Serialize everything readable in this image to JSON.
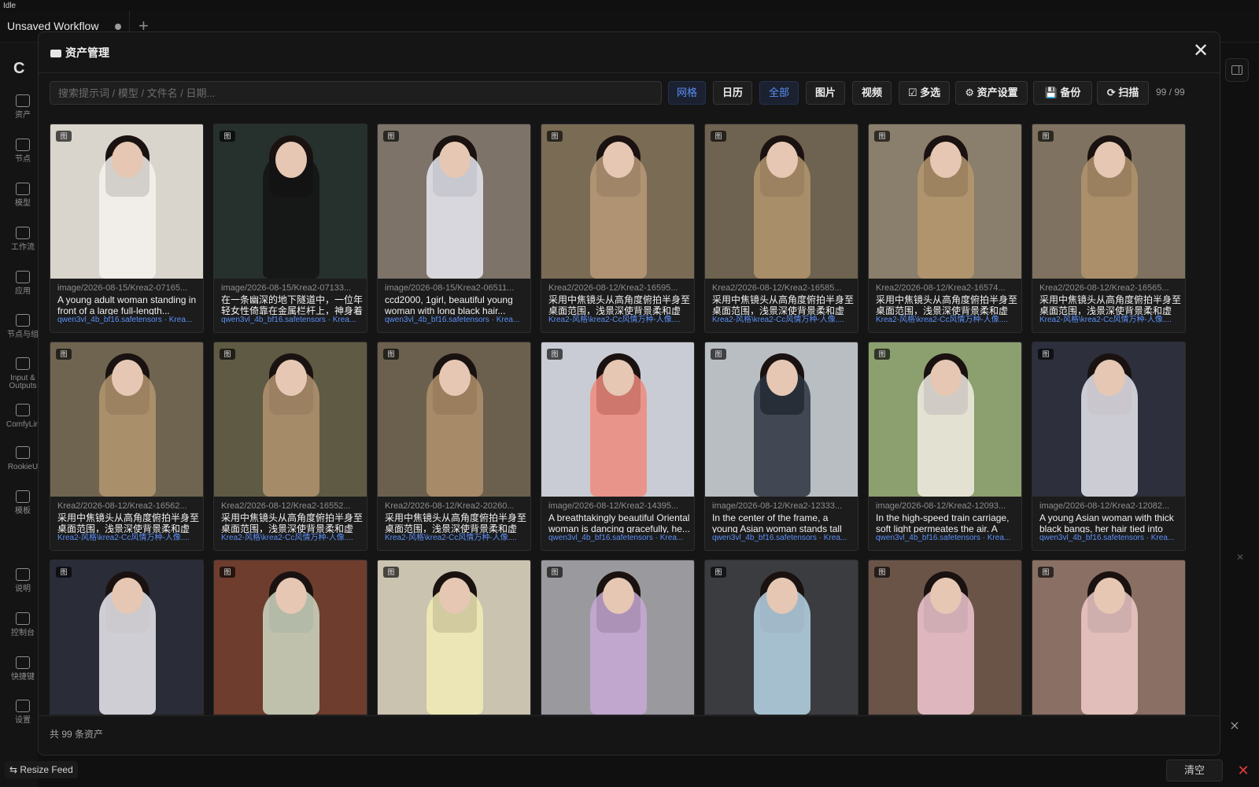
{
  "status": "Idle",
  "workflow_tab": {
    "title": "Unsaved Workflow",
    "add": "+"
  },
  "sidebar": {
    "logo": "C",
    "items": [
      {
        "label": "资产",
        "icon": "image-icon"
      },
      {
        "label": "节点",
        "icon": "node-icon"
      },
      {
        "label": "模型",
        "icon": "model-icon"
      },
      {
        "label": "工作流",
        "icon": "workflow-icon"
      },
      {
        "label": "应用",
        "icon": "app-icon"
      },
      {
        "label": "节点与组",
        "icon": "node-group-icon"
      },
      {
        "label": "Input & Outputs",
        "icon": "io-icon"
      },
      {
        "label": "ComfyLin",
        "icon": "link-icon"
      },
      {
        "label": "RookieU",
        "icon": "compass-icon"
      },
      {
        "label": "模板",
        "icon": "template-icon"
      },
      {
        "label": "说明",
        "icon": "help-icon"
      },
      {
        "label": "控制台",
        "icon": "console-icon"
      },
      {
        "label": "快捷键",
        "icon": "keyboard-icon"
      },
      {
        "label": "设置",
        "icon": "gear-icon"
      }
    ]
  },
  "modal": {
    "title": "资产管理",
    "close": "✕",
    "search_placeholder": "搜索提示词 / 模型 / 文件名 / 日期...",
    "buttons": {
      "grid": "网格",
      "calendar": "日历",
      "all": "全部",
      "image": "图片",
      "video": "视频",
      "multiselect": "☑ 多选",
      "settings": "⚙ 资产设置",
      "backup": "💾 备份",
      "scan": "⟳ 扫描"
    },
    "count": "99 / 99",
    "total": "共 99 条资产",
    "badge": "图",
    "cards": [
      {
        "path": "image/2026-08-15/Krea2-07165...",
        "prompt": "A young adult woman standing in front of a large full-length...",
        "model": "qwen3vl_4b_bf16.safetensors · Krea...",
        "bg": "#d9d4cc",
        "fig": "#f4f1ec"
      },
      {
        "path": "image/2026-08-15/Krea2-07133...",
        "prompt": "在一条幽深的地下隧道中，一位年轻女性倚靠在金属栏杆上，神身着墨...",
        "model": "qwen3vl_4b_bf16.safetensors · Krea...",
        "bg": "#26302c",
        "fig": "#141414"
      },
      {
        "path": "image/2026-08-15/Krea2-06511...",
        "prompt": "ccd2000, 1girl, beautiful young woman with long black hair...",
        "model": "qwen3vl_4b_bf16.safetensors · Krea...",
        "bg": "#7d7368",
        "fig": "#e7e9f2"
      },
      {
        "path": "Krea2/2026-08-12/Krea2-16595...",
        "prompt": "采用中焦镜头从高角度俯拍半身至桌面范围，浅景深使背景柔和虚化...",
        "model": "Krea2-风格\\krea2-Cc风情万种-人像....",
        "bg": "#7a6b55",
        "fig": "#b89a78"
      },
      {
        "path": "Krea2/2026-08-12/Krea2-16585...",
        "prompt": "采用中焦镜头从高角度俯拍半身至桌面范围，浅景深使背景柔和虚化...",
        "model": "Krea2-风格\\krea2-Cc风情万种-人像....",
        "bg": "#6e6250",
        "fig": "#b4966f"
      },
      {
        "path": "Krea2/2026-08-12/Krea2-16574...",
        "prompt": "采用中焦镜头从高角度俯拍半身至桌面范围，浅景深使背景柔和虚化...",
        "model": "Krea2-风格\\krea2-Cc风情万种-人像....",
        "bg": "#8a7e6c",
        "fig": "#b6986f"
      },
      {
        "path": "Krea2/2026-08-12/Krea2-16565...",
        "prompt": "采用中焦镜头从高角度俯拍半身至桌面范围，浅景深使背景柔和虚化...",
        "model": "Krea2-风格\\krea2-Cc风情万种-人像....",
        "bg": "#7f7260",
        "fig": "#b3946d"
      },
      {
        "path": "Krea2/2026-08-12/Krea2-16562...",
        "prompt": "采用中焦镜头从高角度俯拍半身至桌面范围，浅景深使背景柔和虚化...",
        "model": "Krea2-风格\\krea2-Cc风情万种-人像....",
        "bg": "#6f6450",
        "fig": "#b4966f"
      },
      {
        "path": "Krea2/2026-08-12/Krea2-16552...",
        "prompt": "采用中焦镜头从高角度俯拍半身至桌面范围，浅景深使背景柔和虚化...",
        "model": "Krea2-风格\\krea2-Cc风情万种-人像....",
        "bg": "#5e5a44",
        "fig": "#b39470"
      },
      {
        "path": "Krea2/2026-08-12/Krea2-20260...",
        "prompt": "采用中焦镜头从高角度俯拍半身至桌面范围，浅景深使背景柔和虚化...",
        "model": "Krea2-风格\\krea2-Cc风情万种-人像....",
        "bg": "#6b604e",
        "fig": "#b1926c"
      },
      {
        "path": "image/2026-08-12/Krea2-14395...",
        "prompt": "A breathtakingly beautiful Oriental woman is dancing gracefully, he...",
        "model": "qwen3vl_4b_bf16.safetensors · Krea...",
        "bg": "#c9ccd4",
        "fig": "#ef8a7c"
      },
      {
        "path": "image/2026-08-12/Krea2-12333...",
        "prompt": "In the center of the frame, a young Asian woman stands tall with an...",
        "model": "qwen3vl_4b_bf16.safetensors · Krea...",
        "bg": "#b9bec2",
        "fig": "#2c3440"
      },
      {
        "path": "image/2026-08-12/Krea2-12093...",
        "prompt": "In the high-speed train carriage, soft light permeates the air. A 22...",
        "model": "qwen3vl_4b_bf16.safetensors · Krea...",
        "bg": "#8b9f6f",
        "fig": "#f1ece4"
      },
      {
        "path": "image/2026-08-12/Krea2-12082...",
        "prompt": "A young Asian woman with thick black bangs, her hair tied into tai...",
        "model": "qwen3vl_4b_bf16.safetensors · Krea...",
        "bg": "#2d2f3d",
        "fig": "#e9e7ee"
      },
      {
        "path": "",
        "prompt": "",
        "model": "",
        "bg": "#2a2c38",
        "fig": "#ecebf0"
      },
      {
        "path": "",
        "prompt": "",
        "model": "",
        "bg": "#6e3d2e",
        "fig": "#cfd8c2"
      },
      {
        "path": "",
        "prompt": "",
        "model": "",
        "bg": "#c9c3b0",
        "fig": "#f2ecb8"
      },
      {
        "path": "",
        "prompt": "",
        "model": "",
        "bg": "#9a9a9e",
        "fig": "#c8a9d6"
      },
      {
        "path": "",
        "prompt": "",
        "model": "",
        "bg": "#3a3c40",
        "fig": "#b9d6e8"
      },
      {
        "path": "",
        "prompt": "",
        "model": "",
        "bg": "#6a5448",
        "fig": "#f1c9d2"
      },
      {
        "path": "",
        "prompt": "",
        "model": "",
        "bg": "#8a7064",
        "fig": "#f0cbc9"
      }
    ]
  },
  "bottom": {
    "resize_feed": "⇆ Resize Feed",
    "clear": "清空",
    "close_x": "✕"
  }
}
